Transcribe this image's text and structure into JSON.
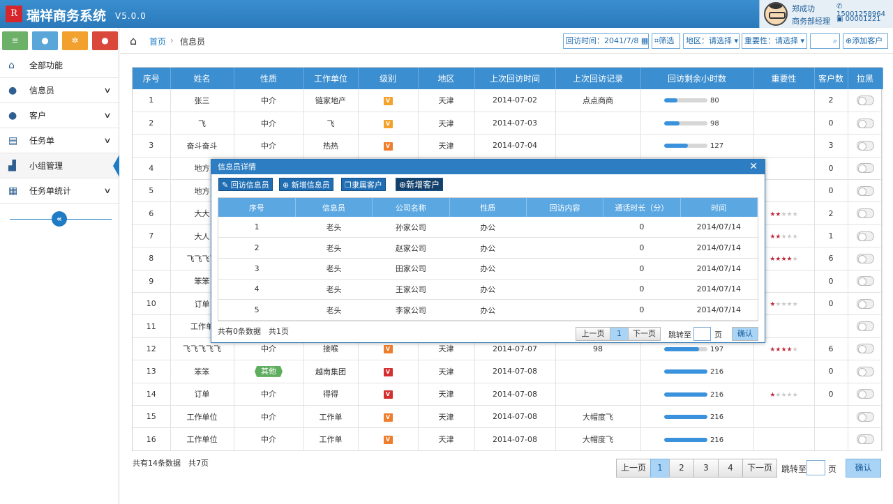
{
  "app": {
    "logo_char": "R",
    "title": "瑞祥商务系统",
    "version": "V5.0.0"
  },
  "user": {
    "name": "郑成功",
    "role": "商务部经理",
    "phone": "15001258964",
    "id": "00001221"
  },
  "quick_buttons": [
    {
      "icon": "note-icon",
      "glyph": "≡",
      "color": "#6db168"
    },
    {
      "icon": "user-icon",
      "glyph": "●",
      "color": "#5aa6d9"
    },
    {
      "icon": "settings-icon",
      "glyph": "✲",
      "color": "#f2a02e"
    },
    {
      "icon": "user-settings-icon",
      "glyph": "●",
      "color": "#d9483a"
    }
  ],
  "sidebar": {
    "items": [
      {
        "label": "全部功能",
        "icon": "home-icon",
        "glyph": "⌂",
        "chevron": false
      },
      {
        "label": "信息员",
        "icon": "user-icon",
        "glyph": "●",
        "chevron": true
      },
      {
        "label": "客户",
        "icon": "user-icon",
        "glyph": "●",
        "chevron": true
      },
      {
        "label": "任务单",
        "icon": "document-icon",
        "glyph": "▤",
        "chevron": true
      },
      {
        "label": "小组管理",
        "icon": "group-icon",
        "glyph": "▟",
        "chevron": false,
        "active": true
      },
      {
        "label": "任务单统计",
        "icon": "stats-icon",
        "glyph": "▦",
        "chevron": true
      }
    ]
  },
  "breadcrumb": {
    "home": "首页",
    "current": "信息员"
  },
  "filters": {
    "visit_time_label": "回访时间：",
    "visit_time_value": "2041/7/8",
    "filter_label": "筛选",
    "region_label": "地区：请选择",
    "importance_label": "重要性：请选择",
    "search_placeholder": "",
    "add_customer": "添加客户"
  },
  "table": {
    "headers": [
      "序号",
      "姓名",
      "性质",
      "工作单位",
      "级别",
      "地区",
      "上次回访时间",
      "上次回访记录",
      "回访剩余小时数",
      "重要性",
      "客户数",
      "拉黑"
    ],
    "rows": [
      {
        "id": "1",
        "name": "张三",
        "type": "中介",
        "unit": "链家地产",
        "level": "V",
        "level_color": "#f4a22b",
        "region": "天津",
        "last_time": "2014-07-02",
        "last_record": "点点商商",
        "progress": 0.3,
        "hours": "80",
        "stars": 0,
        "customers": "2"
      },
      {
        "id": "2",
        "name": "飞",
        "type": "中介",
        "unit": "飞",
        "level": "V",
        "level_color": "#f4a22b",
        "region": "天津",
        "last_time": "2014-07-03",
        "last_record": "",
        "progress": 0.36,
        "hours": "98",
        "stars": 0,
        "customers": "0"
      },
      {
        "id": "3",
        "name": "奋斗奋斗",
        "type": "中介",
        "unit": "热热",
        "level": "V",
        "level_color": "#ef7d2b",
        "region": "天津",
        "last_time": "2014-07-04",
        "last_record": "",
        "progress": 0.55,
        "hours": "127",
        "stars": 0,
        "customers": "3"
      },
      {
        "id": "4",
        "name": "地方",
        "type": "",
        "unit": "",
        "level": "",
        "level_color": "",
        "region": "",
        "last_time": "",
        "last_record": "",
        "progress": 0,
        "hours": "",
        "stars": 0,
        "customers": "0"
      },
      {
        "id": "5",
        "name": "地方",
        "type": "",
        "unit": "",
        "level": "",
        "level_color": "",
        "region": "",
        "last_time": "",
        "last_record": "",
        "progress": 0,
        "hours": "",
        "stars": 0,
        "customers": "0"
      },
      {
        "id": "6",
        "name": "大大",
        "type": "",
        "unit": "",
        "level": "",
        "level_color": "",
        "region": "",
        "last_time": "",
        "last_record": "",
        "progress": 0,
        "hours": "",
        "stars": 2,
        "customers": "2"
      },
      {
        "id": "7",
        "name": "大人",
        "type": "",
        "unit": "",
        "level": "",
        "level_color": "",
        "region": "",
        "last_time": "",
        "last_record": "",
        "progress": 0,
        "hours": "",
        "stars": 2,
        "customers": "1"
      },
      {
        "id": "8",
        "name": "飞飞飞飞",
        "type": "",
        "unit": "",
        "level": "",
        "level_color": "",
        "region": "",
        "last_time": "",
        "last_record": "",
        "progress": 0,
        "hours": "",
        "stars": 4,
        "customers": "6"
      },
      {
        "id": "9",
        "name": "笨笨",
        "type": "",
        "unit": "",
        "level": "",
        "level_color": "",
        "region": "",
        "last_time": "",
        "last_record": "",
        "progress": 0,
        "hours": "",
        "stars": 0,
        "customers": "0"
      },
      {
        "id": "10",
        "name": "订单",
        "type": "",
        "unit": "",
        "level": "",
        "level_color": "",
        "region": "",
        "last_time": "",
        "last_record": "",
        "progress": 0,
        "hours": "",
        "stars": 1,
        "customers": "0"
      },
      {
        "id": "11",
        "name": "工作单",
        "type": "",
        "unit": "",
        "level": "",
        "level_color": "",
        "region": "",
        "last_time": "",
        "last_record": "",
        "progress": 0,
        "hours": "",
        "stars": 0,
        "customers": ""
      },
      {
        "id": "12",
        "name": "飞飞飞飞飞",
        "type": "中介",
        "unit": "接喉",
        "level": "V",
        "level_color": "#ef7d2b",
        "region": "天津",
        "last_time": "2014-07-07",
        "last_record": "98",
        "progress": 0.8,
        "hours": "197",
        "stars": 4,
        "customers": "6"
      },
      {
        "id": "13",
        "name": "笨笨",
        "type": "其他",
        "tag": true,
        "unit": "越南集团",
        "level": "V",
        "level_color": "#d62f2f",
        "region": "天津",
        "last_time": "2014-07-08",
        "last_record": "",
        "progress": 1,
        "hours": "216",
        "stars": 0,
        "customers": "0"
      },
      {
        "id": "14",
        "name": "订单",
        "type": "中介",
        "unit": "得得",
        "level": "V",
        "level_color": "#d62f2f",
        "region": "天津",
        "last_time": "2014-07-08",
        "last_record": "",
        "progress": 1,
        "hours": "216",
        "stars": 1,
        "customers": "0"
      },
      {
        "id": "15",
        "name": "工作单位",
        "type": "中介",
        "unit": "工作单",
        "level": "V",
        "level_color": "#ef7d2b",
        "region": "天津",
        "last_time": "2014-07-08",
        "last_record": "大帽度飞",
        "progress": 1,
        "hours": "216",
        "stars": 0,
        "customers": ""
      },
      {
        "id": "16",
        "name": "工作单位",
        "type": "中介",
        "unit": "工作单",
        "level": "V",
        "level_color": "#ef7d2b",
        "region": "天津",
        "last_time": "2014-07-08",
        "last_record": "大帽度飞",
        "progress": 1,
        "hours": "216",
        "stars": 0,
        "customers": ""
      }
    ]
  },
  "footer": {
    "info": "共有14条数据　共7页",
    "prev": "上一页",
    "pages": [
      "1",
      "2",
      "3",
      "4"
    ],
    "next": "下一页",
    "jump_label": "跳转至",
    "page_unit": "页",
    "confirm": "确认"
  },
  "modal": {
    "title": "信息员详情",
    "close": "✕",
    "buttons": [
      "回访信息员",
      "新增信息员",
      "隶属客户",
      "新增客户"
    ],
    "headers": [
      "序号",
      "信息员",
      "公司名称",
      "性质",
      "回访内容",
      "通话时长（分）",
      "时间"
    ],
    "rows": [
      [
        "1",
        "老头",
        "孙家公司",
        "办公",
        "",
        "0",
        "2014/07/14"
      ],
      [
        "2",
        "老头",
        "赵家公司",
        "办公",
        "",
        "0",
        "2014/07/14"
      ],
      [
        "3",
        "老头",
        "田家公司",
        "办公",
        "",
        "0",
        "2014/07/14"
      ],
      [
        "4",
        "老头",
        "王家公司",
        "办公",
        "",
        "0",
        "2014/07/14"
      ],
      [
        "5",
        "老头",
        "李家公司",
        "办公",
        "",
        "0",
        "2014/07/14"
      ]
    ],
    "info": "共有0条数据　共1页",
    "prev": "上一页",
    "page": "1",
    "next": "下一页",
    "jump_label": "跳转至",
    "page_unit": "页",
    "confirm": "确认"
  }
}
